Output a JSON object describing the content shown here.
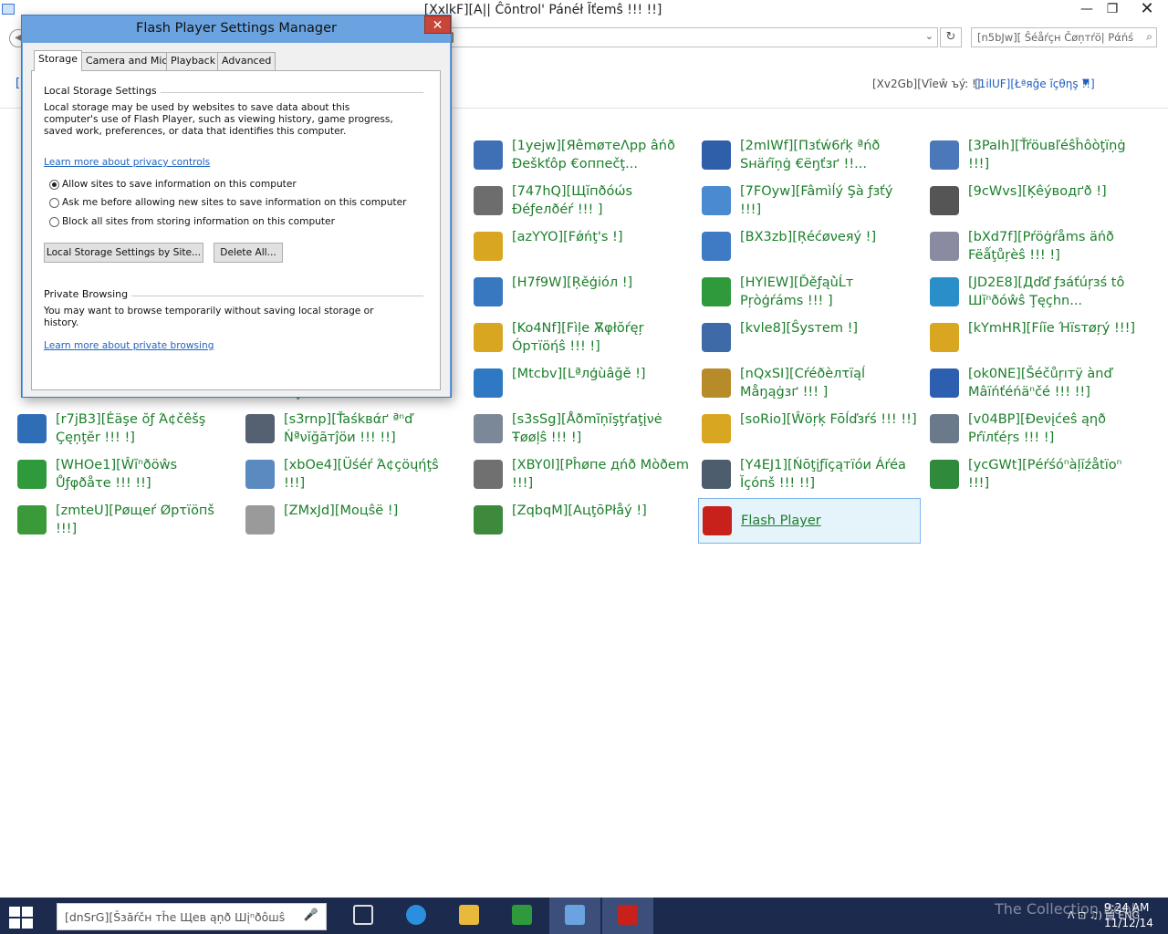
{
  "window": {
    "title": "[XxlkF][A|| Ĉõntrol' Pánéł Ĩťemŝ !!! !!]",
    "minimize": "—",
    "maximize": "❐",
    "close": "✕"
  },
  "toolbar": {
    "back": "◀",
    "address": "]",
    "address_chevron": "⌄",
    "refresh": "↻",
    "search_placeholder": "[n5bJw][ Ŝéåŕçн Čøņтŕö| Ράńśľ...",
    "search_icon": "search-icon"
  },
  "view": {
    "label": "[Xv2Gb][Vîеŵ ъý: !]",
    "value": "[1ilUF][Łªяğe ĭçθηş !!]",
    "arrow": "▼",
    "left_mark": "["
  },
  "items": [
    {
      "label": "[1yejw][ЯêmøтеΛpp âńð Đeškťôp €оппеčţ...",
      "icon": "remote-desktop-icon",
      "color": "#3f6fb5"
    },
    {
      "label": "[2mIWf][Пзťẃ6ŕķ ªńð Sнäŕĭņġ €ёŋťзґ !!...",
      "icon": "network-sharing-icon",
      "color": "#2f5fa8"
    },
    {
      "label": "[3PaIh][Ťŕöuвľéŝĥôòţïņġ !!!]",
      "icon": "troubleshooting-icon",
      "color": "#4b78b8"
    },
    {
      "label": "[747hQ][Щĭпðóώѕ Ðéƒелðéŕ !!! ]",
      "icon": "windows-defender-icon",
      "color": "#6d6d6d"
    },
    {
      "label": "[7FOyw][Fâmìĺý Şà ƒзťý !!!]",
      "icon": "family-safety-icon",
      "color": "#4a8ad0"
    },
    {
      "label": "[9cWvs][Ķêýводґð !]",
      "icon": "keyboard-icon",
      "color": "#555555"
    },
    {
      "label": "[azYYO][Fǿńţ's !]",
      "icon": "fonts-icon",
      "color": "#d9a621"
    },
    {
      "label": "[BX3zb][Ŗéćøνеяý !]",
      "icon": "recovery-icon",
      "color": "#3e7bc4"
    },
    {
      "label": "[bXd7f][Pŕöġŕåms äńð Fëǻţůŗèŝ !!! !]",
      "icon": "programs-features-icon",
      "color": "#8a8aa0"
    },
    {
      "label": "[H7f9W][Ŗěģiόл !]",
      "icon": "region-icon",
      "color": "#3778c0"
    },
    {
      "label": "[HYIEW][Ďěƒąù̀Ĺт Pŗòģŕáms !!! ]",
      "icon": "default-programs-icon",
      "color": "#2f9a3c"
    },
    {
      "label": "[JD2E8][Дďď ƒзáťúŗзś tô Шĭⁿðóŵŝ Ţęçhn...",
      "icon": "add-features-icon",
      "color": "#2a8fc8"
    },
    {
      "label": "[Ko4Nf][Fìļe Ѫφłŏŕęŗ Óртïöήŝ !!! !]",
      "icon": "folder-options-icon",
      "color": "#d9a621"
    },
    {
      "label": "[kvle8][Ŝуѕтеm !]",
      "icon": "system-icon",
      "color": "#3e6aa8"
    },
    {
      "label": "[kYmHR][Fíĭe Ήïѕтøŗý !!!]",
      "icon": "file-history-icon",
      "color": "#d9a621"
    },
    {
      "label": "[Mtcbv][Lªлģùâğě !]",
      "icon": "language-icon",
      "color": "#2f78c4"
    },
    {
      "label": "[nQxSI][Cŕéðèлτïąĺ Μåŋąġзґ !!! ]",
      "icon": "credential-manager-icon",
      "color": "#b78a2a"
    },
    {
      "label": "[ok0NE][Šéčůŗıтÿ ànď Mâïńťéńäⁿčé !!! !!]",
      "icon": "security-maintenance-icon",
      "color": "#2d5fb0"
    },
    {
      "label": "[r7jB3][Ėäşe ŏƒ Ά¢čêšş Çęņţĕr !!! !]",
      "icon": "ease-of-access-icon",
      "color": "#2f6db7"
    },
    {
      "label": "[s3rnp][Ťaśkвάґ ªⁿď Ńªνĭğãтĵöи !!! !!]",
      "icon": "taskbar-navigation-icon",
      "color": "#556070"
    },
    {
      "label": "[s3sSg][Åðmĩņĭşţŕaţįνė Ŧøøļŝ !!! !]",
      "icon": "administrative-tools-icon",
      "color": "#7a8898"
    },
    {
      "label": "[soRio][Ŵöŗķ Fōĺďзŕś !!! !!]",
      "icon": "work-folders-icon",
      "color": "#d9a621"
    },
    {
      "label": "[v04BP][Ðеνįćеŝ ąηð Ρŕïлťéŗs !!! !]",
      "icon": "devices-printers-icon",
      "color": "#6a7a8a"
    },
    {
      "label": "[WHOe1][Ŵĭⁿðöŵѕ Ůƒφðåτе !!! !!]",
      "icon": "windows-update-icon",
      "color": "#2f9a3c"
    },
    {
      "label": "[xbOe4][Üśéŕ Ά¢çöųήţŝ !!!]",
      "icon": "user-accounts-icon",
      "color": "#5a8ac0"
    },
    {
      "label": "[XBY0l][Ρĥøпе дńð Μòðеm !!!]",
      "icon": "phone-modem-icon",
      "color": "#707070"
    },
    {
      "label": "[Y4EJ1][Ńōţįƒĭçąтïóи Áŕéа Ĭçóпš !!! !!]",
      "icon": "notification-area-icon",
      "color": "#4d5d6d"
    },
    {
      "label": "[ycGWt][Ρéŕśóⁿàļĭźåtïoⁿ !!!]",
      "icon": "personalization-icon",
      "color": "#2f8a3c"
    },
    {
      "label": "[zmteU][Ρøщеŕ Øрτïöпš !!!]",
      "icon": "power-options-icon",
      "color": "#3a9a3a"
    },
    {
      "label": "[ZMxJd][Μоцŝë !]",
      "icon": "mouse-icon",
      "color": "#9a9a9a"
    },
    {
      "label": "[ZqbqM][ΑцţōΡłåý !]",
      "icon": "autoplay-icon",
      "color": "#3d8a3d"
    },
    {
      "label": "Flash Player",
      "icon": "flash-player-icon",
      "color": "#c8201a"
    }
  ],
  "partial_left": {
    "row3_edge": "]",
    "row5_edge": "!!]"
  },
  "flash": {
    "title": "Flash Player Settings Manager",
    "close": "✕",
    "tabs": [
      "Storage",
      "Camera and Mic",
      "Playback",
      "Advanced"
    ],
    "storage_title": "Local Storage Settings",
    "storage_desc": "Local storage may be used by websites to save data about this computer's use of Flash Player, such as viewing history, game progress, saved work, preferences, or data that identifies this computer.",
    "privacy_link": "Learn more about privacy controls",
    "radios": [
      {
        "label": "Allow sites to save information on this computer",
        "checked": true
      },
      {
        "label": "Ask me before allowing new sites to save information on this computer",
        "checked": false
      },
      {
        "label": "Block all sites from storing information on this computer",
        "checked": false
      }
    ],
    "by_site_button": "Local Storage Settings by Site...",
    "delete_button": "Delete All...",
    "private_title": "Private Browsing",
    "private_desc": "You may want to browse temporarily without saving local storage or history.",
    "private_link": "Learn more about private browsing"
  },
  "taskbar": {
    "search_placeholder": "[dnSrG][Šзăŕčн тĥе Щев ąņð Шįⁿðôшŝ",
    "mic": "🎤",
    "tray": "ᐱ  ⊡  ♫)  ▤  ENG",
    "time": "9:24 AM",
    "date": "11/12/14"
  },
  "watermark": "The Collection Book"
}
